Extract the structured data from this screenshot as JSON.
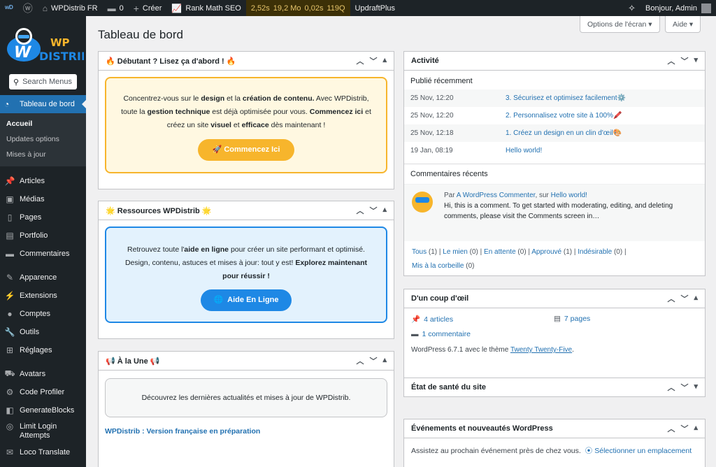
{
  "adminbar": {
    "site_name": "WPDistrib FR",
    "comments_count": "0",
    "new_label": "Créer",
    "rankmath_label": "Rank Math SEO",
    "stats": [
      "2,52s",
      "19,2 Mo",
      "0,02s",
      "119Q"
    ],
    "updraft_label": "UpdraftPlus",
    "greeting": "Bonjour, Admin"
  },
  "sidebar": {
    "search_placeholder": "Search Menus",
    "current": "Tableau de bord",
    "submenu": [
      "Accueil",
      "Updates options",
      "Mises à jour"
    ],
    "items_a": [
      "Articles",
      "Médias",
      "Pages",
      "Portfolio",
      "Commentaires"
    ],
    "items_b": [
      "Apparence",
      "Extensions",
      "Comptes",
      "Outils",
      "Réglages"
    ],
    "items_c": [
      "Avatars",
      "Code Profiler",
      "GenerateBlocks"
    ],
    "limit_login": "Limit Login Attempts",
    "loco": "Loco Translate"
  },
  "header": {
    "title": "Tableau de bord",
    "screen_options": "Options de l'écran ▾",
    "help": "Aide ▾"
  },
  "debutant": {
    "title": "🔥 Débutant ? Lisez ça d'abord ! 🔥",
    "p1": "Concentrez-vous sur le ",
    "b1": "design",
    "p2": " et la ",
    "b2": "création de contenu.",
    "p3": " Avec WPDistrib, toute la ",
    "b3": "gestion technique",
    "p4": " est déjà optimisée pour vous. ",
    "b4": "Commencez ici",
    "p5": " et créez un site ",
    "b5": "visuel",
    "p6": " et ",
    "b6": "efficace",
    "p7": " dès maintenant !",
    "button": "🚀 Commencez Ici"
  },
  "ressources": {
    "title": "🌟 Ressources WPDistrib 🌟",
    "p1": "Retrouvez toute l'",
    "b1": "aide en ligne",
    "p2": " pour créer un site performant et optimisé. Design, contenu, astuces et mises à jour: tout y est! ",
    "b2": "Explorez maintenant pour réussir !",
    "button": "Aide En Ligne"
  },
  "une": {
    "title": "📢 À la Une 📢",
    "text": "Découvrez les dernières actualités et mises à jour de WPDistrib.",
    "link": "WPDistrib : Version française en préparation"
  },
  "activite": {
    "title": "Activité",
    "recent_heading": "Publié récemment",
    "rows": [
      {
        "date": "25 Nov, 12:20",
        "title": "3. Sécurisez et optimisez facilement⚙️"
      },
      {
        "date": "25 Nov, 12:20",
        "title": "2. Personnalisez votre site à 100%🖍️"
      },
      {
        "date": "25 Nov, 12:18",
        "title": "1. Créez un design en un clin d'œil🎨"
      },
      {
        "date": "19 Jan, 08:19",
        "title": "Hello world!"
      }
    ],
    "comments_heading": "Commentaires récents",
    "comment_by": "Par ",
    "comment_author": "A WordPress Commenter",
    "comment_on": ", sur ",
    "comment_post": "Hello world!",
    "comment_text": "Hi, this is a comment. To get started with moderating, editing, and deleting comments, please visit the Comments screen in…",
    "filters": [
      {
        "label": "Tous",
        "count": "(1)"
      },
      {
        "label": "Le mien",
        "count": "(0)"
      },
      {
        "label": "En attente",
        "count": "(0)"
      },
      {
        "label": "Approuvé",
        "count": "(1)"
      },
      {
        "label": "Indésirable",
        "count": "(0)"
      },
      {
        "label": "Mis à la corbeille",
        "count": "(0)"
      }
    ]
  },
  "coupdoeil": {
    "title": "D'un coup d'œil",
    "articles": "4 articles",
    "pages": "7 pages",
    "comment": "1 commentaire",
    "footer_pre": "WordPress 6.7.1 avec le thème ",
    "theme": "Twenty Twenty-Five",
    "footer_post": "."
  },
  "sante": {
    "title": "État de santé du site"
  },
  "events": {
    "title": "Événements et nouveautés WordPress",
    "text": "Assistez au prochain événement près de chez vous.",
    "link": "Sélectionner un emplacement"
  },
  "colors": {
    "accent": "#2271b1",
    "orange": "#f7b52c",
    "blue_btn": "#1e88e5",
    "dark": "#1d2327"
  }
}
